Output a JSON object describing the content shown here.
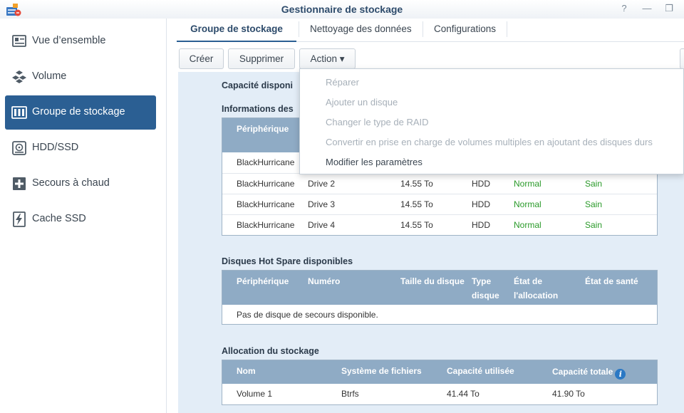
{
  "window": {
    "title": "Gestionnaire de stockage",
    "help_glyph": "?",
    "minimize_glyph": "—",
    "maximize_glyph": "❐"
  },
  "sidebar": {
    "items": [
      {
        "label": "Vue d’ensemble",
        "icon": "overview-icon"
      },
      {
        "label": "Volume",
        "icon": "volume-icon"
      },
      {
        "label": "Groupe de stockage",
        "icon": "storage-pool-icon",
        "active": true
      },
      {
        "label": "HDD/SSD",
        "icon": "hdd-icon"
      },
      {
        "label": "Secours à chaud",
        "icon": "hot-spare-icon"
      },
      {
        "label": "Cache SSD",
        "icon": "ssd-cache-icon"
      }
    ]
  },
  "tabs": [
    {
      "label": "Groupe de stockage",
      "active": true
    },
    {
      "label": "Nettoyage des données"
    },
    {
      "label": "Configurations"
    }
  ],
  "toolbar": {
    "create_label": "Créer",
    "delete_label": "Supprimer",
    "action_label": "Action ▾"
  },
  "action_menu": {
    "items": [
      {
        "label": "Réparer",
        "enabled": false
      },
      {
        "label": "Ajouter un disque",
        "enabled": false
      },
      {
        "label": "Changer le type de RAID",
        "enabled": false
      },
      {
        "label": "Convertir en prise en charge de volumes multiples en ajoutant des disques durs",
        "enabled": false
      },
      {
        "label": "Modifier les paramètres",
        "enabled": true
      }
    ]
  },
  "main": {
    "capacity_title": "Capacité disponi",
    "disks_section": {
      "title": "Informations des",
      "header_device": "Périphérique",
      "rows": [
        {
          "device": "BlackHurricane",
          "number": "",
          "size": "",
          "type": "",
          "allocation": "",
          "health": ""
        },
        {
          "device": "BlackHurricane",
          "number": "Drive 2",
          "size": "14.55 To",
          "type": "HDD",
          "allocation": "Normal",
          "health": "Sain"
        },
        {
          "device": "BlackHurricane",
          "number": "Drive 3",
          "size": "14.55 To",
          "type": "HDD",
          "allocation": "Normal",
          "health": "Sain"
        },
        {
          "device": "BlackHurricane",
          "number": "Drive 4",
          "size": "14.55 To",
          "type": "HDD",
          "allocation": "Normal",
          "health": "Sain"
        }
      ]
    },
    "hot_spare_section": {
      "title": "Disques Hot Spare disponibles",
      "headers": {
        "device": "Périphérique",
        "number": "Numéro",
        "size": "Taille du disque",
        "type_line1": "Type",
        "type_line2": "disque",
        "alloc_line1": "État de",
        "alloc_line2": "l'allocation",
        "health": "État de santé"
      },
      "empty_message": "Pas de disque de secours disponible."
    },
    "allocation_section": {
      "title": "Allocation du stockage",
      "headers": {
        "name": "Nom",
        "filesystem": "Système de fichiers",
        "used": "Capacité utilisée",
        "total": "Capacité totale"
      },
      "rows": [
        {
          "name": "Volume 1",
          "filesystem": "Btrfs",
          "used": "41.44 To",
          "total": "41.90 To"
        }
      ]
    }
  },
  "colors": {
    "accent": "#2b5f93",
    "table_header": "#8fabc5",
    "content_bg": "#e3edf7",
    "status_green": "#2a9a29"
  }
}
